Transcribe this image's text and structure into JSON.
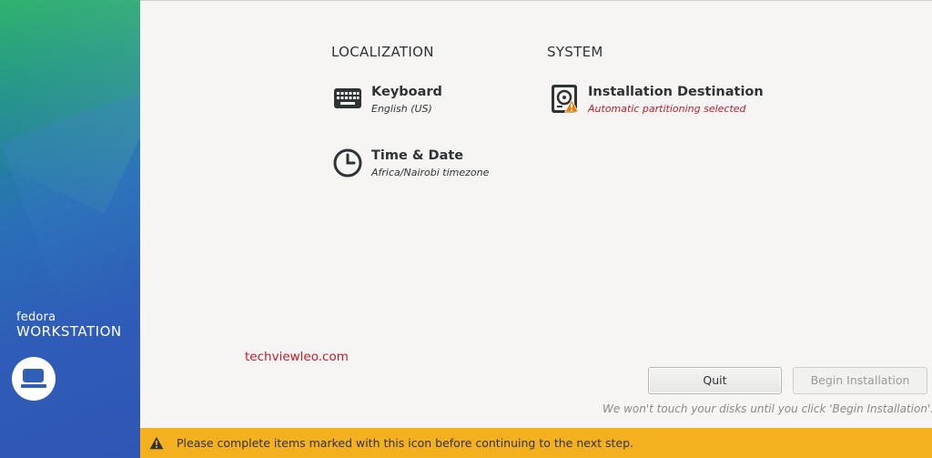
{
  "sidebar": {
    "brand_small": "fedora",
    "brand_big": "WORKSTATION",
    "logo_icon": "workstation-laptop-icon"
  },
  "localization": {
    "title": "LOCALIZATION",
    "keyboard": {
      "label": "Keyboard",
      "status": "English (US)",
      "icon": "keyboard-icon"
    },
    "time_date": {
      "label": "Time & Date",
      "status": "Africa/Nairobi timezone",
      "icon": "clock-icon"
    }
  },
  "system": {
    "title": "SYSTEM",
    "installation_destination": {
      "label": "Installation Destination",
      "status": "Automatic partitioning selected",
      "icon": "harddisk-icon",
      "warning": true
    }
  },
  "watermark": "techviewleo.com",
  "buttons": {
    "quit": "Quit",
    "begin": "Begin Installation"
  },
  "disk_note": "We won't touch your disks until you click 'Begin Installation'.",
  "warning_bar": {
    "text": "Please complete items marked with this icon before continuing to the next step."
  },
  "colors": {
    "warning_bar": "#f5b01f",
    "warning_text": "#c01c28",
    "sidebar_top": "#1fa86a",
    "sidebar_bottom": "#2f56b4"
  }
}
